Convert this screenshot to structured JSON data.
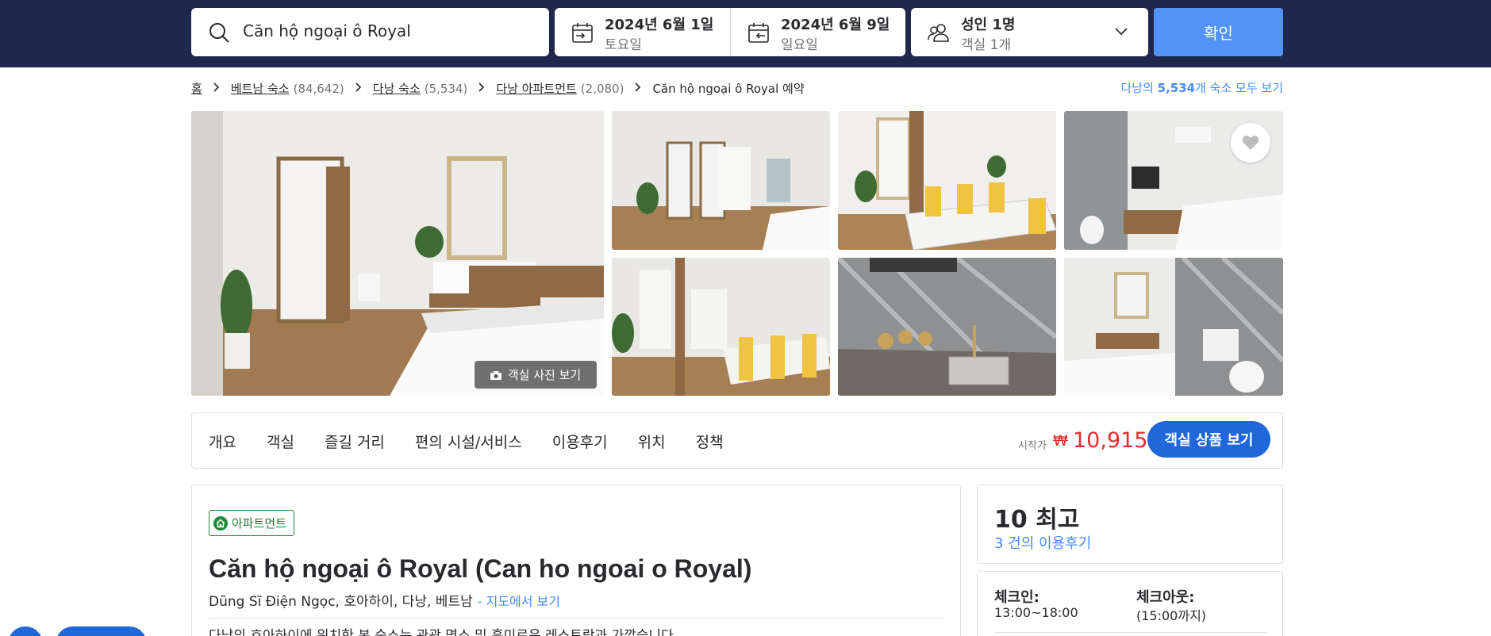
{
  "search": {
    "destination": "Căn hộ ngoại ô Royal",
    "checkin_date": "2024년 6월 1일",
    "checkin_day": "토요일",
    "checkout_date": "2024년 6월 9일",
    "checkout_day": "일요일",
    "guests_main": "성인 1명",
    "guests_sub": "객실 1개",
    "confirm_label": "확인"
  },
  "breadcrumb": {
    "items": [
      {
        "label": "홈",
        "count": ""
      },
      {
        "label": "베트남 숙소",
        "count": "(84,642)"
      },
      {
        "label": "다낭 숙소",
        "count": "(5,534)"
      },
      {
        "label": "다낭 아파트먼트",
        "count": "(2,080)"
      }
    ],
    "current": "Căn hộ ngoại ô Royal 예약",
    "see_all_prefix": "다낭의 ",
    "see_all_count": "5,534",
    "see_all_suffix": "개 숙소 모두 보기"
  },
  "gallery": {
    "room_photos_label": "객실 사진 보기"
  },
  "nav": {
    "tabs": [
      "개요",
      "객실",
      "즐길 거리",
      "편의 시설/서비스",
      "이용후기",
      "위치",
      "정책"
    ],
    "price_from_label": "시작가",
    "currency": "₩",
    "price": "10,915",
    "room_offers_label": "객실 상품 보기"
  },
  "property": {
    "type_badge": "아파트먼트",
    "title": "Căn hộ ngoại ô Royal (Can ho ngoai o Royal)",
    "address": "Dũng Sĩ Điện Ngọc, 호아하이, 다낭, 베트남",
    "map_link": "- 지도에서 보기",
    "description": "다낭의 호아하이에 위치한 본 숙소는 관광 명소 및 흥미로운 레스토랑과 가깝습니다."
  },
  "review": {
    "score_num": "10",
    "score_word": "최고",
    "reviews_link": "3 건의 이용후기"
  },
  "checkin": {
    "checkin_label": "체크인:",
    "checkin_value": "13:00~18:00",
    "checkout_label": "체크아웃:",
    "checkout_value": "(15:00까지)"
  },
  "colors": {
    "header_bg": "#20274d",
    "confirm_bg": "#5392f9",
    "primary_button": "#2067da",
    "link": "#488bf8",
    "price": "#e12d2d",
    "badge_green": "#1f7a35"
  }
}
